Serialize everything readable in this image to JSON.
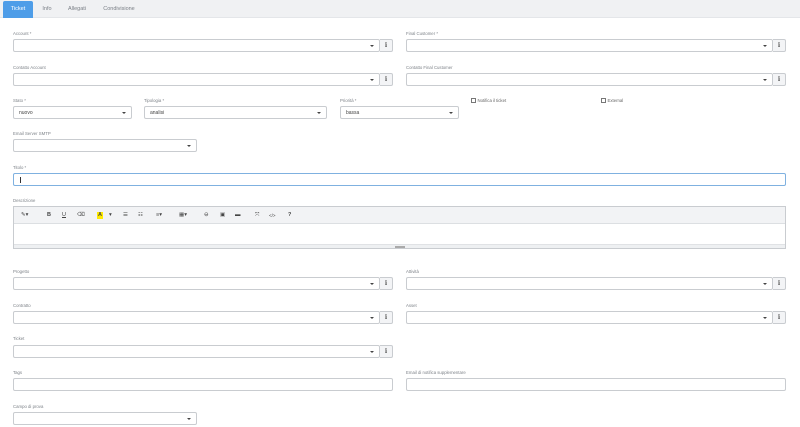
{
  "tabs": [
    {
      "label": "Ticket"
    },
    {
      "label": "Info"
    },
    {
      "label": "Allegati"
    },
    {
      "label": "Condivisione"
    }
  ],
  "form": {
    "account_label": "Account *",
    "final_customer_label": "Final Customer *",
    "contatto_account_label": "Contatto Account",
    "contatto_final_customer_label": "Contatto Final Customer",
    "stato_label": "Stato *",
    "stato_value": "nuovo",
    "tipologia_label": "Tipologia *",
    "tipologia_value": "analisi",
    "priorita_label": "Priorità *",
    "priorita_value": "bassa",
    "notifica_label": "Notifica il ticket",
    "external_label": "External",
    "email_server_label": "Email Server SMTP",
    "titolo_label": "Titolo *",
    "descrizione_label": "Descrizione",
    "progetto_label": "Progetto",
    "attivita_label": "Attività",
    "contratto_label": "Contratto",
    "asset_label": "Asset",
    "ticket_label": "Ticket",
    "tags_label": "Tags",
    "email_notifica_label": "Email di notifica supplementare",
    "campo_prova_label": "Campo di prova",
    "info_glyph": "i"
  },
  "editor_toolbar": {
    "magic": "✎▾",
    "bold": "B",
    "underline": "U",
    "eraser": "⌫",
    "color": "A",
    "color_caret": "▾",
    "ul": "☰",
    "ol": "☷",
    "align": "≡▾",
    "table": "▦▾",
    "link": "⊖",
    "picture": "▣",
    "video": "▬",
    "fullscreen": "⤧",
    "code": "</>",
    "help": "?"
  },
  "colors": {
    "accent": "#4e9de8",
    "highlight": "#ffea00"
  }
}
